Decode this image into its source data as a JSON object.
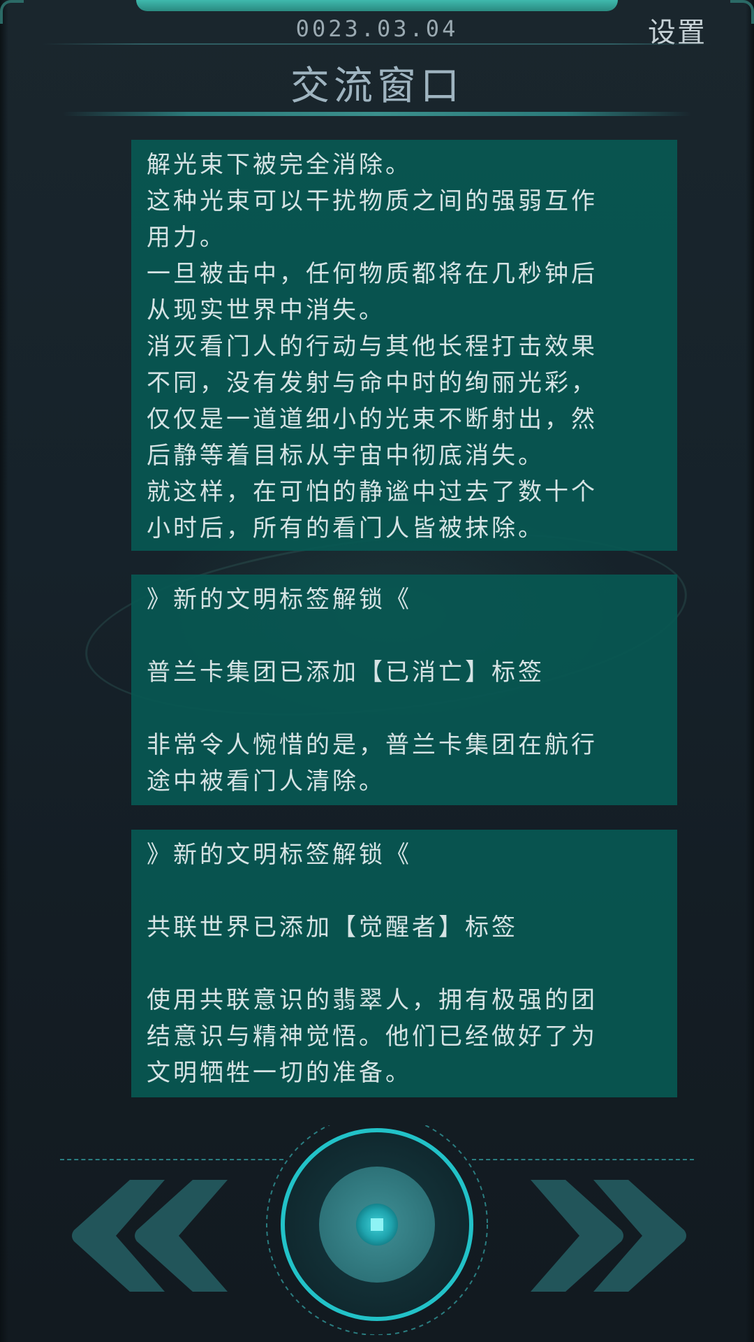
{
  "header": {
    "date": "0023.03.04",
    "settings_label": "设置",
    "title": "交流窗口"
  },
  "messages": [
    {
      "lines": [
        "解光束下被完全消除。",
        "这种光束可以干扰物质之间的强弱互作",
        "用力。",
        "一旦被击中，任何物质都将在几秒钟后",
        "从现实世界中消失。",
        "消灭看门人的行动与其他长程打击效果",
        "不同，没有发射与命中时的绚丽光彩，",
        "仅仅是一道道细小的光束不断射出，然",
        "后静等着目标从宇宙中彻底消失。",
        "就这样，在可怕的静谧中过去了数十个",
        "小时后，所有的看门人皆被抹除。"
      ]
    },
    {
      "heading": "》新的文明标签解锁《",
      "tag_line": "普兰卡集团已添加【已消亡】标签",
      "desc_lines": [
        "非常令人惋惜的是，普兰卡集团在航行",
        "途中被看门人清除。"
      ]
    },
    {
      "heading": "》新的文明标签解锁《",
      "tag_line": "共联世界已添加【觉醒者】标签",
      "desc_lines": [
        "使用共联意识的翡翠人，拥有极强的团",
        "结意识与精神觉悟。他们已经做好了为",
        "文明牺牲一切的准备。"
      ]
    }
  ],
  "controls": {
    "prev_icon": "double-chevron-left-icon",
    "next_icon": "double-chevron-right-icon",
    "center_icon": "stop-square-icon"
  },
  "colors": {
    "panel": "#085852",
    "accent": "#3fb9ad",
    "text": "#d5e3e4",
    "arrow": "#22555a",
    "center_core": "#8ef3f5"
  }
}
